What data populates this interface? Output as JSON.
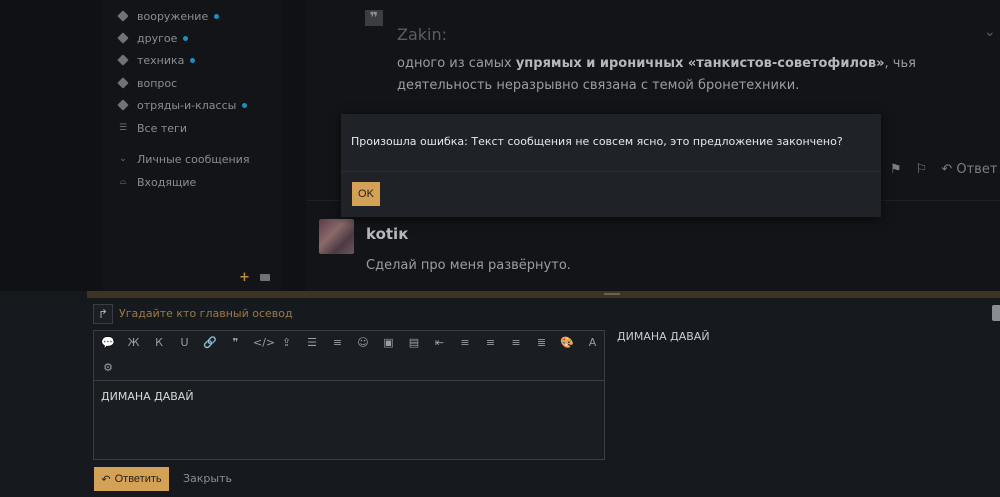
{
  "sidebar": {
    "items": [
      {
        "label": "вооружение",
        "icon": "tag-icon",
        "dot": true
      },
      {
        "label": "другое",
        "icon": "tag-icon",
        "dot": true
      },
      {
        "label": "техника",
        "icon": "tag-icon",
        "dot": true
      },
      {
        "label": "вопрос",
        "icon": "tag-icon",
        "dot": false
      },
      {
        "label": "отряды-и-классы",
        "icon": "tag-icon",
        "dot": true
      },
      {
        "label": "Все теги",
        "icon": "list-icon",
        "dot": false
      }
    ],
    "pm_section": {
      "label": "Личные сообщения",
      "icon": "chevron-down-icon"
    },
    "inbox": {
      "label": "Входящие",
      "icon": "inbox-icon"
    },
    "tools": {
      "add_icon": "plus-icon",
      "keyboard_icon": "keyboard-icon"
    }
  },
  "quote": {
    "author": "Zakin:",
    "text_before": "одного из самых ",
    "text_bold": "упрямых и ироничных «танкистов-советофилов»",
    "text_after": ", чья деятельность неразрывно связана с темой бронетехники."
  },
  "post_actions": {
    "reply_label": "Ответ"
  },
  "post": {
    "author": "kotік",
    "text": "Сделай про меня развёрнуто."
  },
  "modal": {
    "message": "Произошла ошибка: Текст сообщения не совсем ясно, это предложение закончено?",
    "ok_label": "OK"
  },
  "reply": {
    "title": "Угадайте кто главный осевод",
    "editor_value": "ДИМАНА ДАВАЙ",
    "preview_text": "ДИМАНА ДАВАЙ",
    "submit_label": "Ответить",
    "close_label": "Закрыть"
  },
  "toolbar": {
    "buttons": [
      {
        "glyph": "💬",
        "name": "comment-icon"
      },
      {
        "glyph": "Ж",
        "name": "bold-icon"
      },
      {
        "glyph": "К",
        "name": "italic-icon"
      },
      {
        "glyph": "U",
        "name": "underline-icon"
      },
      {
        "glyph": "🔗",
        "name": "link-icon"
      },
      {
        "glyph": "❞",
        "name": "quote-icon"
      },
      {
        "glyph": "</>",
        "name": "code-icon"
      },
      {
        "glyph": "⇪",
        "name": "upload-icon"
      },
      {
        "glyph": "☰",
        "name": "bullet-list-icon"
      },
      {
        "glyph": "≡",
        "name": "numbered-list-icon"
      },
      {
        "glyph": "☺",
        "name": "emoji-icon"
      },
      {
        "glyph": "▣",
        "name": "media-icon"
      },
      {
        "glyph": "▤",
        "name": "image-icon"
      },
      {
        "glyph": "⇤",
        "name": "indent-icon"
      },
      {
        "glyph": "≡",
        "name": "align-left-icon"
      },
      {
        "glyph": "≡",
        "name": "align-center-icon"
      },
      {
        "glyph": "≡",
        "name": "align-right-icon"
      },
      {
        "glyph": "≣",
        "name": "justify-icon"
      },
      {
        "glyph": "🎨",
        "name": "palette-icon"
      },
      {
        "glyph": "A",
        "name": "font-icon"
      },
      {
        "glyph": "⚙",
        "name": "gear-icon"
      }
    ]
  },
  "colors": {
    "accent": "#d4a256",
    "tag_dot": "#1f8fb8",
    "modal_bg": "#1f2328"
  }
}
